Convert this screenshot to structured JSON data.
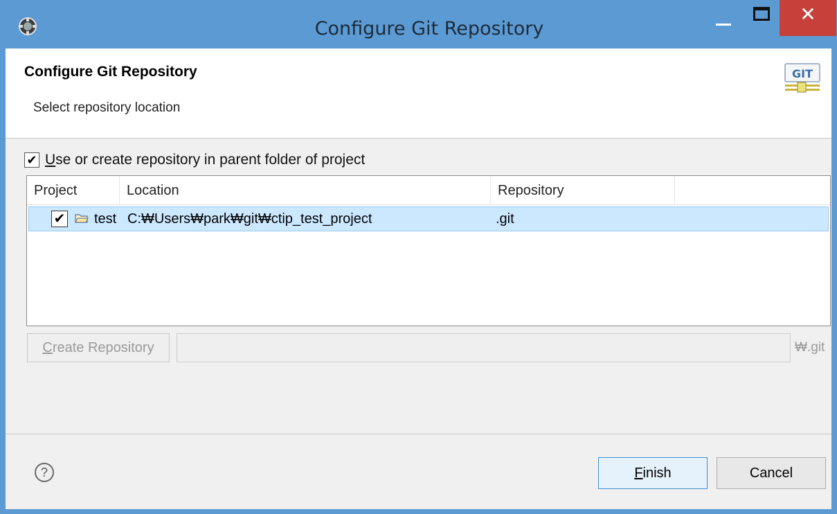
{
  "window": {
    "title": "Configure Git Repository",
    "close_glyph": "✕"
  },
  "banner": {
    "title": "Configure Git Repository",
    "description": "Select repository location",
    "logo_text": "GIT"
  },
  "options": {
    "use_parent_checked": true,
    "use_parent_mnemonic": "U",
    "use_parent_rest": "se or create repository in parent folder of project",
    "check_glyph": "✔"
  },
  "table": {
    "columns": [
      "Project",
      "Location",
      "Repository"
    ],
    "rows": [
      {
        "checked": true,
        "project": "test",
        "location": "C:₩Users₩park₩git₩ctip_test_project",
        "repository": ".git"
      }
    ]
  },
  "create": {
    "button_mnemonic": "C",
    "button_rest": "reate Repository",
    "field_value": "",
    "suffix": "₩.git"
  },
  "footer": {
    "help_glyph": "?",
    "finish_mnemonic": "F",
    "finish_rest": "inish",
    "cancel_label": "Cancel"
  },
  "colors": {
    "titlebar": "#5b9ad3",
    "close": "#c7413a",
    "selection": "#cce8ff"
  }
}
